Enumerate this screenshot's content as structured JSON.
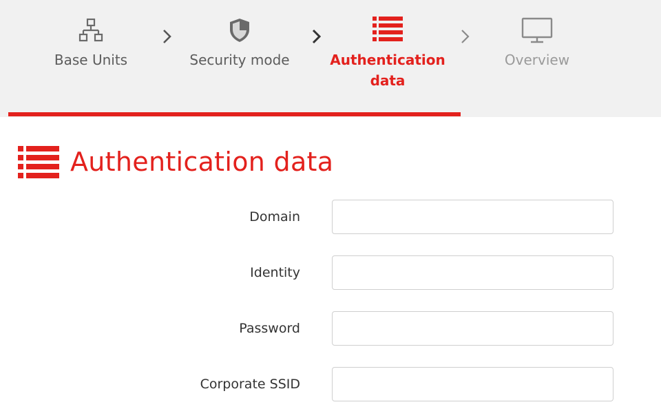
{
  "wizard": {
    "steps": [
      {
        "icon": "network-icon",
        "label": "Base Units",
        "state": "done"
      },
      {
        "icon": "shield-icon",
        "label": "Security mode",
        "state": "done"
      },
      {
        "icon": "list-icon",
        "label": "Authentication data",
        "state": "active"
      },
      {
        "icon": "monitor-icon",
        "label": "Overview",
        "state": "future"
      }
    ]
  },
  "section": {
    "icon": "list-icon",
    "title": "Authentication data"
  },
  "form": {
    "fields": [
      {
        "label": "Domain",
        "value": "",
        "placeholder": ""
      },
      {
        "label": "Identity",
        "value": "",
        "placeholder": ""
      },
      {
        "label": "Password",
        "value": "",
        "placeholder": ""
      },
      {
        "label": "Corporate SSID",
        "value": "",
        "placeholder": ""
      }
    ]
  },
  "colors": {
    "accent": "#e3211d",
    "wizard_background": "#f1f1f1",
    "text": "#5c5c5c",
    "future_text": "#9a9a9a"
  }
}
